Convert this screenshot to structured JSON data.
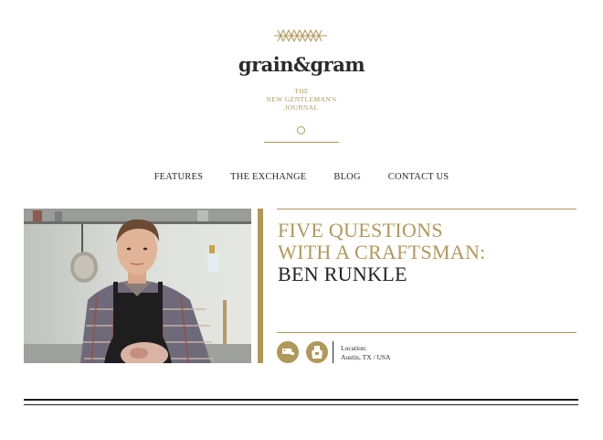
{
  "brand": {
    "logo": "grain&gram",
    "tagline": [
      "THE",
      "NEW GENTLEMAN'S",
      "JOURNAL"
    ],
    "ornament_icon": "diamond-lattice-ornament",
    "accent_color": "#b0985a"
  },
  "nav": {
    "items": [
      {
        "label": "FEATURES"
      },
      {
        "label": "THE EXCHANGE"
      },
      {
        "label": "BLOG"
      },
      {
        "label": "CONTACT US"
      }
    ]
  },
  "feature": {
    "headline_line1": "FIVE QUESTIONS",
    "headline_line2": "WITH A CRAFTSMAN:",
    "headline_line3": "BEN RUNKLE",
    "icons": [
      "cleaver-icon",
      "apron-icon"
    ],
    "location_label": "Location:",
    "location_value": "Austin, TX / USA"
  }
}
